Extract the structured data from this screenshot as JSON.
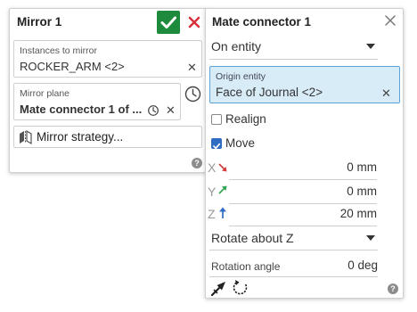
{
  "mirror_panel": {
    "title": "Mirror 1",
    "instances_label": "Instances to mirror",
    "instances_value": "ROCKER_ARM <2>",
    "plane_label": "Mirror plane",
    "plane_value": "Mate connector 1 of ...",
    "strategy_label": "Mirror strategy..."
  },
  "mate_panel": {
    "title": "Mate connector 1",
    "placement_select": "On entity",
    "origin_label": "Origin entity",
    "origin_value": "Face of Journal <2>",
    "realign_label": "Realign",
    "realign_checked": false,
    "move_label": "Move",
    "move_checked": true,
    "x_label": "X",
    "x_value": "0 mm",
    "y_label": "Y",
    "y_value": "0 mm",
    "z_label": "Z",
    "z_value": "20 mm",
    "rotate_select": "Rotate about Z",
    "rotation_label": "Rotation angle",
    "rotation_value": "0 deg"
  },
  "colors": {
    "accept_green": "#1e8b3c",
    "cancel_red": "#d9333f",
    "selection_blue": "#d8ecf8",
    "checkbox_blue": "#2f6cc4"
  },
  "icons": {
    "help": "?"
  }
}
